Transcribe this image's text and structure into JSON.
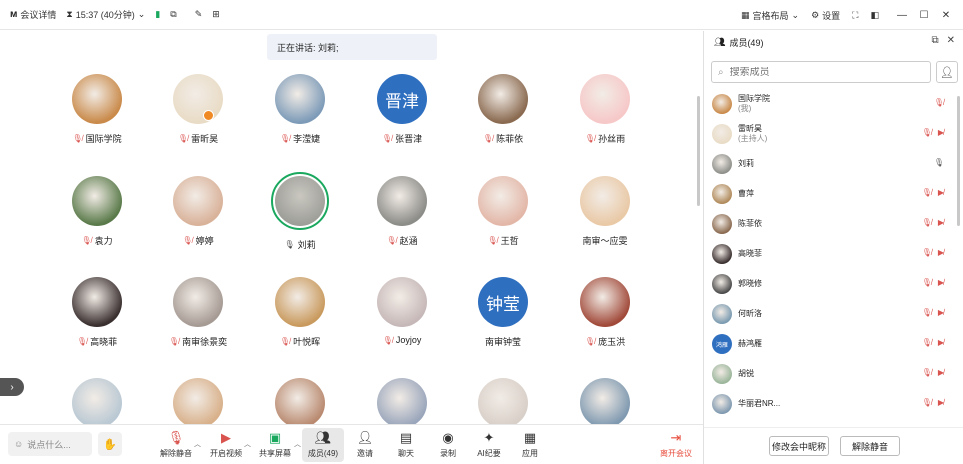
{
  "topbar": {
    "meeting_details": "会议详情",
    "time": "15:37 (40分钟)",
    "grid_layout": "宫格布局",
    "settings": "设置"
  },
  "speaking": "正在讲话: 刘莉;",
  "tiles": [
    {
      "name": "国际学院",
      "mic": "muted",
      "color": "#c98a4a"
    },
    {
      "name": "雷昕昊",
      "mic": "muted",
      "color": "#e9dcc6",
      "host_badge": true
    },
    {
      "name": "李滢婕",
      "mic": "muted",
      "color": "#7d9bb8"
    },
    {
      "name": "张晋津",
      "mic": "muted",
      "text": "晋津"
    },
    {
      "name": "陈菲依",
      "mic": "muted",
      "color": "#8a6a50"
    },
    {
      "name": "孙丝雨",
      "mic": "muted",
      "color": "#f6c8c8"
    },
    {
      "name": "袁力",
      "mic": "muted",
      "color": "#5a7a4a"
    },
    {
      "name": "婷婷",
      "mic": "muted",
      "color": "#d9b29a"
    },
    {
      "name": "刘莉",
      "mic": "on",
      "color": "#8e8f8a",
      "active": true
    },
    {
      "name": "赵涵",
      "mic": "muted",
      "color": "#8c8c88"
    },
    {
      "name": "王哲",
      "mic": "muted",
      "color": "#e3b7a8"
    },
    {
      "name": "南审～应雯",
      "mic": "none",
      "color": "#e9c9a6"
    },
    {
      "name": "高晓菲",
      "mic": "muted",
      "color": "#3a3030"
    },
    {
      "name": "南审徐景奕",
      "mic": "muted",
      "color": "#a69b94"
    },
    {
      "name": "叶悦晖",
      "mic": "muted",
      "color": "#c99a5e"
    },
    {
      "name": "Joyjoy",
      "mic": "muted",
      "color": "#c6b8b8"
    },
    {
      "name": "南审钟莹",
      "mic": "none",
      "text": "钟莹"
    },
    {
      "name": "庞玉洪",
      "mic": "muted",
      "color": "#a14a3a"
    },
    {
      "name": "",
      "mic": "none",
      "color": "#b9c8d3"
    },
    {
      "name": "",
      "mic": "none",
      "color": "#d8b08a"
    },
    {
      "name": "",
      "mic": "none",
      "color": "#b98a70"
    },
    {
      "name": "",
      "mic": "none",
      "color": "#9aa6bb"
    },
    {
      "name": "",
      "mic": "none",
      "color": "#d8cfc8"
    },
    {
      "name": "",
      "mic": "none",
      "color": "#7f99b0"
    }
  ],
  "toolbar": {
    "chat_placeholder": "说点什么...",
    "unmute": "解除静音",
    "start_video": "开启视频",
    "share_screen": "共享屏幕",
    "members": "成员(49)",
    "invite": "邀请",
    "chat": "聊天",
    "record": "录制",
    "ai_minutes": "AI纪要",
    "apps": "应用",
    "leave": "离开会议"
  },
  "panel": {
    "title": "成员(49)",
    "search_placeholder": "搜索成员",
    "members": [
      {
        "name": "国际学院",
        "sub": "(我)",
        "color": "#c98a4a",
        "icons": [
          "muted"
        ]
      },
      {
        "name": "雷昕昊",
        "sub": "(主持人)",
        "color": "#e9dcc6",
        "icons": [
          "muted",
          "video-off"
        ]
      },
      {
        "name": "刘莉",
        "sub": "",
        "color": "#8e8f8a",
        "icons": [
          "mic-on"
        ]
      },
      {
        "name": "曹萍",
        "sub": "",
        "color": "#b08a5a",
        "icons": [
          "muted",
          "video-off"
        ]
      },
      {
        "name": "陈菲依",
        "sub": "",
        "color": "#8a6a50",
        "icons": [
          "muted",
          "video-off"
        ]
      },
      {
        "name": "高晓菲",
        "sub": "",
        "color": "#3a3030",
        "icons": [
          "muted",
          "video-off"
        ]
      },
      {
        "name": "郭晓修",
        "sub": "",
        "color": "#4a4a4a",
        "icons": [
          "muted",
          "video-off"
        ]
      },
      {
        "name": "何昕洛",
        "sub": "",
        "color": "#7a9ab0",
        "icons": [
          "muted",
          "video-off"
        ]
      },
      {
        "name": "赫鸿雁",
        "sub": "",
        "color": "#2f6fc0",
        "text": "鸿雁",
        "icons": [
          "muted",
          "video-off"
        ]
      },
      {
        "name": "胡锐",
        "sub": "",
        "color": "#9ab59a",
        "icons": [
          "muted",
          "video-off"
        ]
      },
      {
        "name": "华丽君NR...",
        "sub": "",
        "color": "#7f99b0",
        "icons": [
          "muted",
          "video-off"
        ]
      }
    ],
    "rename_button": "修改会中昵称",
    "unmute_all_button": "解除静音"
  }
}
